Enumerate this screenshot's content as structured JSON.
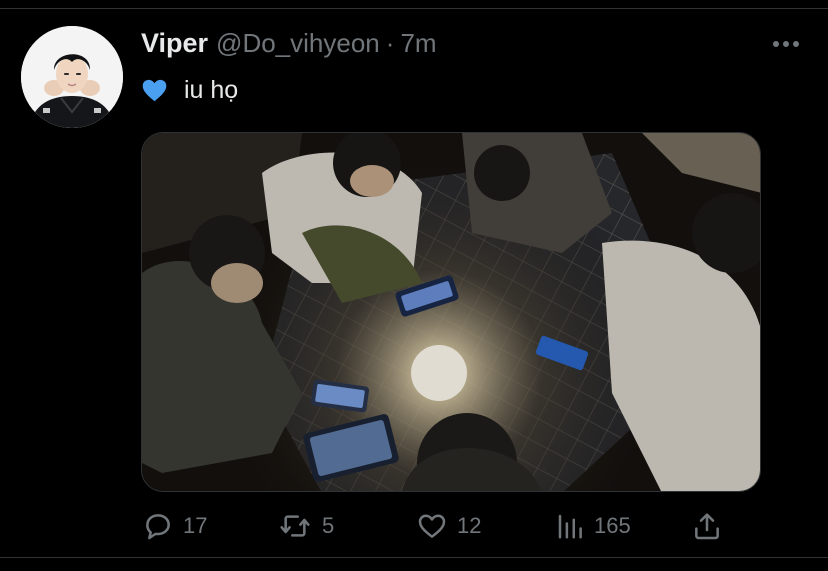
{
  "tweet": {
    "display_name": "Viper",
    "handle": "@Do_vihyeon",
    "separator": "·",
    "time": "7m",
    "text": "iu họ",
    "emoji": "blue-heart"
  },
  "actions": {
    "reply_count": "17",
    "retweet_count": "5",
    "like_count": "12",
    "views_count": "165"
  },
  "colors": {
    "background": "#000000",
    "primary_text": "#e7e9ea",
    "secondary_text": "#71767b",
    "divider": "#2f3336",
    "emoji_blue": "#4a9ff0"
  },
  "icons": [
    "more-icon",
    "reply-icon",
    "retweet-icon",
    "like-icon",
    "views-icon",
    "share-icon"
  ]
}
